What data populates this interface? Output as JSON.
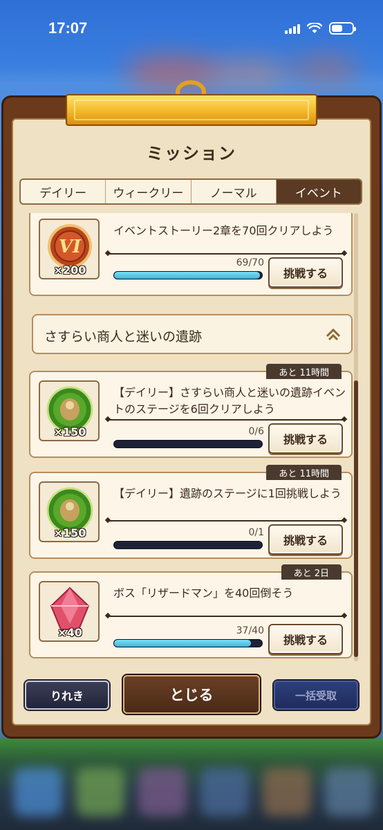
{
  "status_bar": {
    "time": "17:07"
  },
  "dialog": {
    "title": "ミッション",
    "tabs": [
      {
        "label": "デイリー",
        "active": false
      },
      {
        "label": "ウィークリー",
        "active": false
      },
      {
        "label": "ノーマル",
        "active": false
      },
      {
        "label": "イベント",
        "active": true
      }
    ],
    "section": {
      "title": "さすらい商人と迷いの遺跡"
    },
    "missions": [
      {
        "text": "イベントストーリー2章を70回クリアしよう",
        "reward_icon": "rank-medal-icon",
        "reward_qty": "×200",
        "progress_text": "69/70",
        "progress": 0.985,
        "button": "挑戦する"
      },
      {
        "text": "【デイリー】さすらい商人と迷いの遺跡イベントのステージを6回クリアしよう",
        "reward_icon": "event-coin-icon",
        "reward_qty": "×150",
        "progress_text": "0/6",
        "progress": 0,
        "button": "挑戦する",
        "time_left": "あと 11時間"
      },
      {
        "text": "【デイリー】遺跡のステージに1回挑戦しよう",
        "reward_icon": "event-coin-icon",
        "reward_qty": "×150",
        "progress_text": "0/1",
        "progress": 0,
        "button": "挑戦する",
        "time_left": "あと 11時間"
      },
      {
        "text": "ボス「リザードマン」を40回倒そう",
        "reward_icon": "red-crystal-icon",
        "reward_qty": "×40",
        "progress_text": "37/40",
        "progress": 0.925,
        "button": "挑戦する",
        "time_left": "あと 2日"
      }
    ],
    "buttons": {
      "history": "りれき",
      "close": "とじる",
      "bulk_receive": "一括受取"
    }
  },
  "colors": {
    "frame_brown": "#6b3a1c",
    "parchment": "#efe1c3",
    "active_tab": "#5a3a22",
    "progress_fill": "#3fb5d8",
    "bulk_button": "#1f2c5c"
  }
}
